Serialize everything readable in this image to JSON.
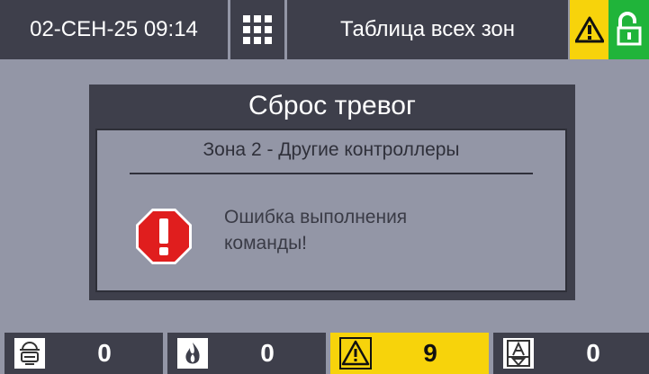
{
  "header": {
    "datetime": "02-СЕН-25  09:14",
    "title": "Таблица всех зон",
    "menu_icon": "grid-icon",
    "warning_icon": "warning-icon",
    "lock_icon": "unlock-icon"
  },
  "dialog": {
    "title": "Сброс тревог",
    "zone": "Зона 2 - Другие контроллеры",
    "message_line1": "Ошибка выполнения",
    "message_line2": "команды!",
    "icon": "error-stop-icon"
  },
  "counters": [
    {
      "icon": "fire-alarm-icon",
      "value": "0"
    },
    {
      "icon": "flame-icon",
      "value": "0"
    },
    {
      "icon": "warning-icon",
      "value": "9"
    },
    {
      "icon": "fault-icon",
      "value": "0"
    }
  ],
  "colors": {
    "background": "#9396a6",
    "panel": "#3e3f4b",
    "warning": "#f7d30b",
    "ok": "#20b43a",
    "error": "#e01e1e"
  }
}
